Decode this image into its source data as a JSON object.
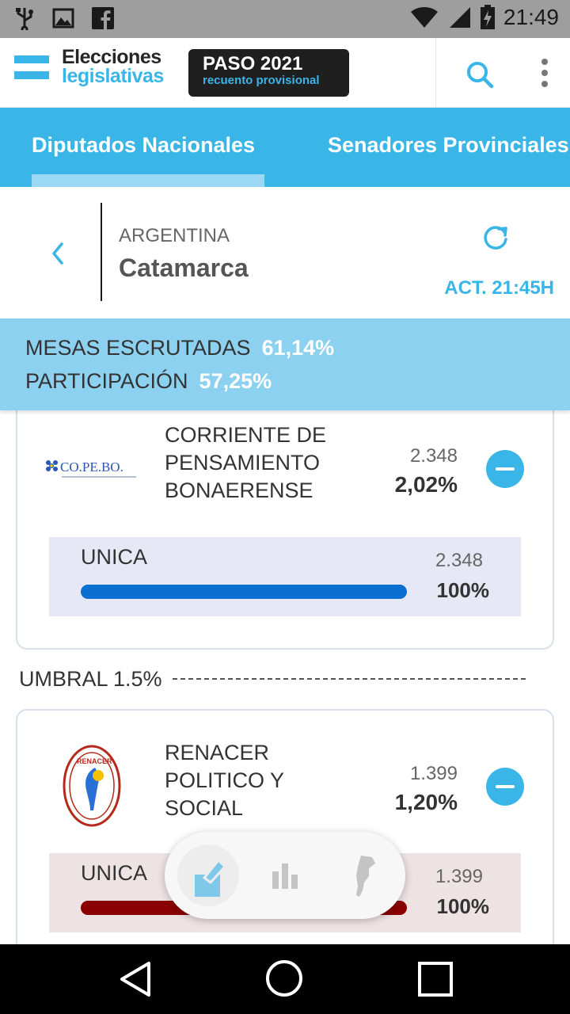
{
  "status_bar": {
    "time": "21:49",
    "icons": [
      "usb-icon",
      "image-icon",
      "facebook-icon",
      "wifi-icon",
      "signal-icon",
      "battery-charging-icon"
    ]
  },
  "header": {
    "brand_line1": "Elecciones",
    "brand_line2": "legislativas",
    "badge_title": "PASO 2021",
    "badge_subtitle": "recuento provisional"
  },
  "tabs": [
    {
      "label": "Diputados Nacionales",
      "active": true
    },
    {
      "label": "Senadores Provinciales",
      "active": false
    }
  ],
  "location": {
    "country": "ARGENTINA",
    "province": "Catamarca",
    "updated": "ACT. 21:45H"
  },
  "stats": {
    "mesas_label": "MESAS ESCRUTADAS",
    "mesas_value": "61,14%",
    "participacion_label": "PARTICIPACIÓN",
    "participacion_value": "57,25%"
  },
  "threshold": {
    "label": "UMBRAL 1.5%"
  },
  "parties": [
    {
      "logo_text": "CO.PE.BO.",
      "name": "CORRIENTE DE PENSAMIENTO BONAERENSE",
      "votes": "2.348",
      "percent": "2,02%",
      "list": {
        "name": "UNICA",
        "votes": "2.348",
        "percent": "100%",
        "share": 1.0
      },
      "colors": {
        "bar": "#0a6fd0",
        "list_bg": "#e6e9f5"
      }
    },
    {
      "logo_text": "RENACER",
      "name": "RENACER POLITICO Y SOCIAL",
      "votes": "1.399",
      "percent": "1,20%",
      "list": {
        "name": "UNICA",
        "votes": "1.399",
        "percent": "100%",
        "share": 1.0
      },
      "colors": {
        "bar": "#8b0000",
        "list_bg": "#ede3e3"
      }
    }
  ],
  "colors": {
    "accent": "#3ab5e8",
    "stats_band": "#8dd1f0",
    "status_bar": "#9e9e9e"
  }
}
